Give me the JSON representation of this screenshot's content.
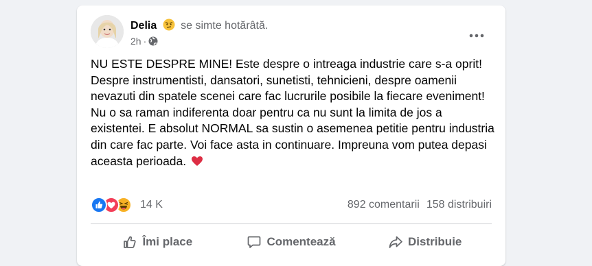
{
  "post": {
    "author": "Delia",
    "feeling_text": "se simte hotărâtă.",
    "time": "2h",
    "time_separator": "·",
    "body": [
      "NU ESTE DESPRE MINE! Este despre o intreaga industrie care s-a oprit! Despre instrumentisti, dansatori, sunetisti, tehnicieni, despre oamenii nevazuti din spatele scenei care fac lucrurile posibile la fiecare eveniment!",
      "Nu o sa raman indiferenta doar pentru ca nu sunt la limita de jos a existentei. E absolut NORMAL sa sustin o asemenea petitie pentru industria din care fac parte. Voi face asta in continuare. Impreuna vom putea depasi aceasta perioada."
    ]
  },
  "stats": {
    "reactions_count": "14 K",
    "comments": "892 comentarii",
    "shares": "158 distribuiri"
  },
  "actions": {
    "like": "Îmi place",
    "comment": "Comentează",
    "share": "Distribuie"
  },
  "colors": {
    "like_blue": "#1877f2",
    "love_red": "#f33e58",
    "haha_yellow": "#f7b125",
    "secondary_text": "#65676b"
  },
  "icons": {
    "feeling": "determined-face-icon",
    "privacy": "globe-icon",
    "menu": "more-horizontal-icon",
    "heart": "red-heart-icon",
    "reactions": [
      "like-reaction-icon",
      "love-reaction-icon",
      "haha-reaction-icon"
    ]
  }
}
